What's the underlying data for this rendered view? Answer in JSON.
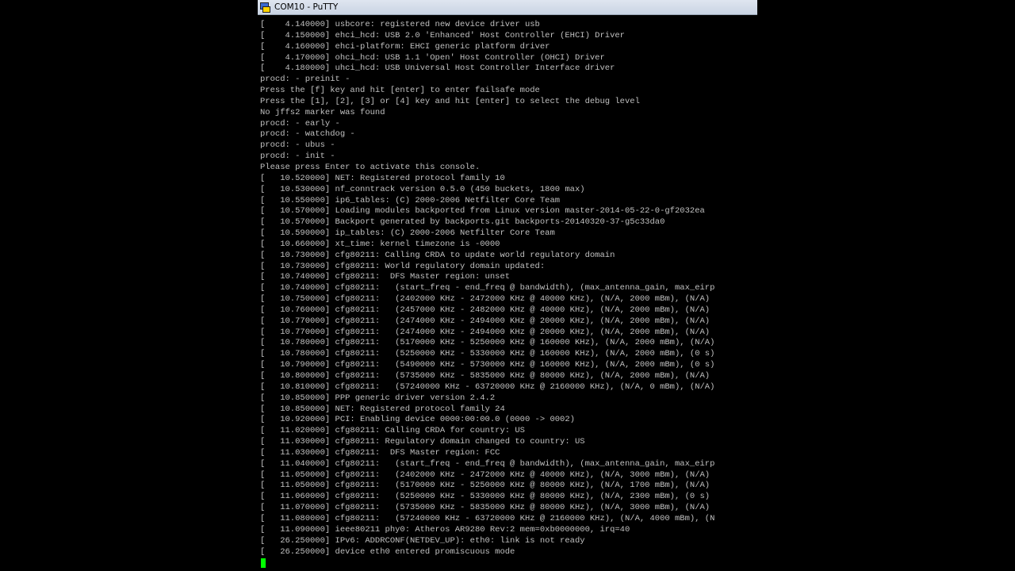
{
  "window": {
    "title": "COM10 - PuTTY",
    "icon": "putty-icon"
  },
  "colors": {
    "background": "#000000",
    "text": "#c0c0c0",
    "cursor": "#00ff00",
    "titlebar": "#d5dde9"
  },
  "terminal": {
    "lines": [
      "[    4.140000] usbcore: registered new device driver usb",
      "[    4.150000] ehci_hcd: USB 2.0 'Enhanced' Host Controller (EHCI) Driver",
      "[    4.160000] ehci-platform: EHCI generic platform driver",
      "[    4.170000] ohci_hcd: USB 1.1 'Open' Host Controller (OHCI) Driver",
      "[    4.180000] uhci_hcd: USB Universal Host Controller Interface driver",
      "procd: - preinit -",
      "Press the [f] key and hit [enter] to enter failsafe mode",
      "Press the [1], [2], [3] or [4] key and hit [enter] to select the debug level",
      "No jffs2 marker was found",
      "procd: - early -",
      "procd: - watchdog -",
      "procd: - ubus -",
      "procd: - init -",
      "Please press Enter to activate this console.",
      "[   10.520000] NET: Registered protocol family 10",
      "[   10.530000] nf_conntrack version 0.5.0 (450 buckets, 1800 max)",
      "[   10.550000] ip6_tables: (C) 2000-2006 Netfilter Core Team",
      "[   10.570000] Loading modules backported from Linux version master-2014-05-22-0-gf2032ea",
      "[   10.570000] Backport generated by backports.git backports-20140320-37-g5c33da0",
      "[   10.590000] ip_tables: (C) 2000-2006 Netfilter Core Team",
      "[   10.660000] xt_time: kernel timezone is -0000",
      "[   10.730000] cfg80211: Calling CRDA to update world regulatory domain",
      "[   10.730000] cfg80211: World regulatory domain updated:",
      "[   10.740000] cfg80211:  DFS Master region: unset",
      "[   10.740000] cfg80211:   (start_freq - end_freq @ bandwidth), (max_antenna_gain, max_eirp",
      "[   10.750000] cfg80211:   (2402000 KHz - 2472000 KHz @ 40000 KHz), (N/A, 2000 mBm), (N/A)",
      "[   10.760000] cfg80211:   (2457000 KHz - 2482000 KHz @ 40000 KHz), (N/A, 2000 mBm), (N/A)",
      "[   10.770000] cfg80211:   (2474000 KHz - 2494000 KHz @ 20000 KHz), (N/A, 2000 mBm), (N/A)",
      "[   10.770000] cfg80211:   (2474000 KHz - 2494000 KHz @ 20000 KHz), (N/A, 2000 mBm), (N/A)",
      "[   10.780000] cfg80211:   (5170000 KHz - 5250000 KHz @ 160000 KHz), (N/A, 2000 mBm), (N/A)",
      "[   10.780000] cfg80211:   (5250000 KHz - 5330000 KHz @ 160000 KHz), (N/A, 2000 mBm), (0 s)",
      "[   10.790000] cfg80211:   (5490000 KHz - 5730000 KHz @ 160000 KHz), (N/A, 2000 mBm), (0 s)",
      "[   10.800000] cfg80211:   (5735000 KHz - 5835000 KHz @ 80000 KHz), (N/A, 2000 mBm), (N/A)",
      "[   10.810000] cfg80211:   (57240000 KHz - 63720000 KHz @ 2160000 KHz), (N/A, 0 mBm), (N/A)",
      "[   10.850000] PPP generic driver version 2.4.2",
      "[   10.850000] NET: Registered protocol family 24",
      "[   10.920000] PCI: Enabling device 0000:00:00.0 (0000 -> 0002)",
      "[   11.020000] cfg80211: Calling CRDA for country: US",
      "[   11.030000] cfg80211: Regulatory domain changed to country: US",
      "[   11.030000] cfg80211:  DFS Master region: FCC",
      "[   11.040000] cfg80211:   (start_freq - end_freq @ bandwidth), (max_antenna_gain, max_eirp",
      "[   11.050000] cfg80211:   (2402000 KHz - 2472000 KHz @ 40000 KHz), (N/A, 3000 mBm), (N/A)",
      "[   11.050000] cfg80211:   (5170000 KHz - 5250000 KHz @ 80000 KHz), (N/A, 1700 mBm), (N/A)",
      "[   11.060000] cfg80211:   (5250000 KHz - 5330000 KHz @ 80000 KHz), (N/A, 2300 mBm), (0 s)",
      "[   11.070000] cfg80211:   (5735000 KHz - 5835000 KHz @ 80000 KHz), (N/A, 3000 mBm), (N/A)",
      "[   11.080000] cfg80211:   (57240000 KHz - 63720000 KHz @ 2160000 KHz), (N/A, 4000 mBm), (N",
      "[   11.090000] ieee80211 phy0: Atheros AR9280 Rev:2 mem=0xb0000000, irq=40",
      "[   26.250000] IPv6: ADDRCONF(NETDEV_UP): eth0: link is not ready",
      "[   26.250000] device eth0 entered promiscuous mode"
    ]
  }
}
